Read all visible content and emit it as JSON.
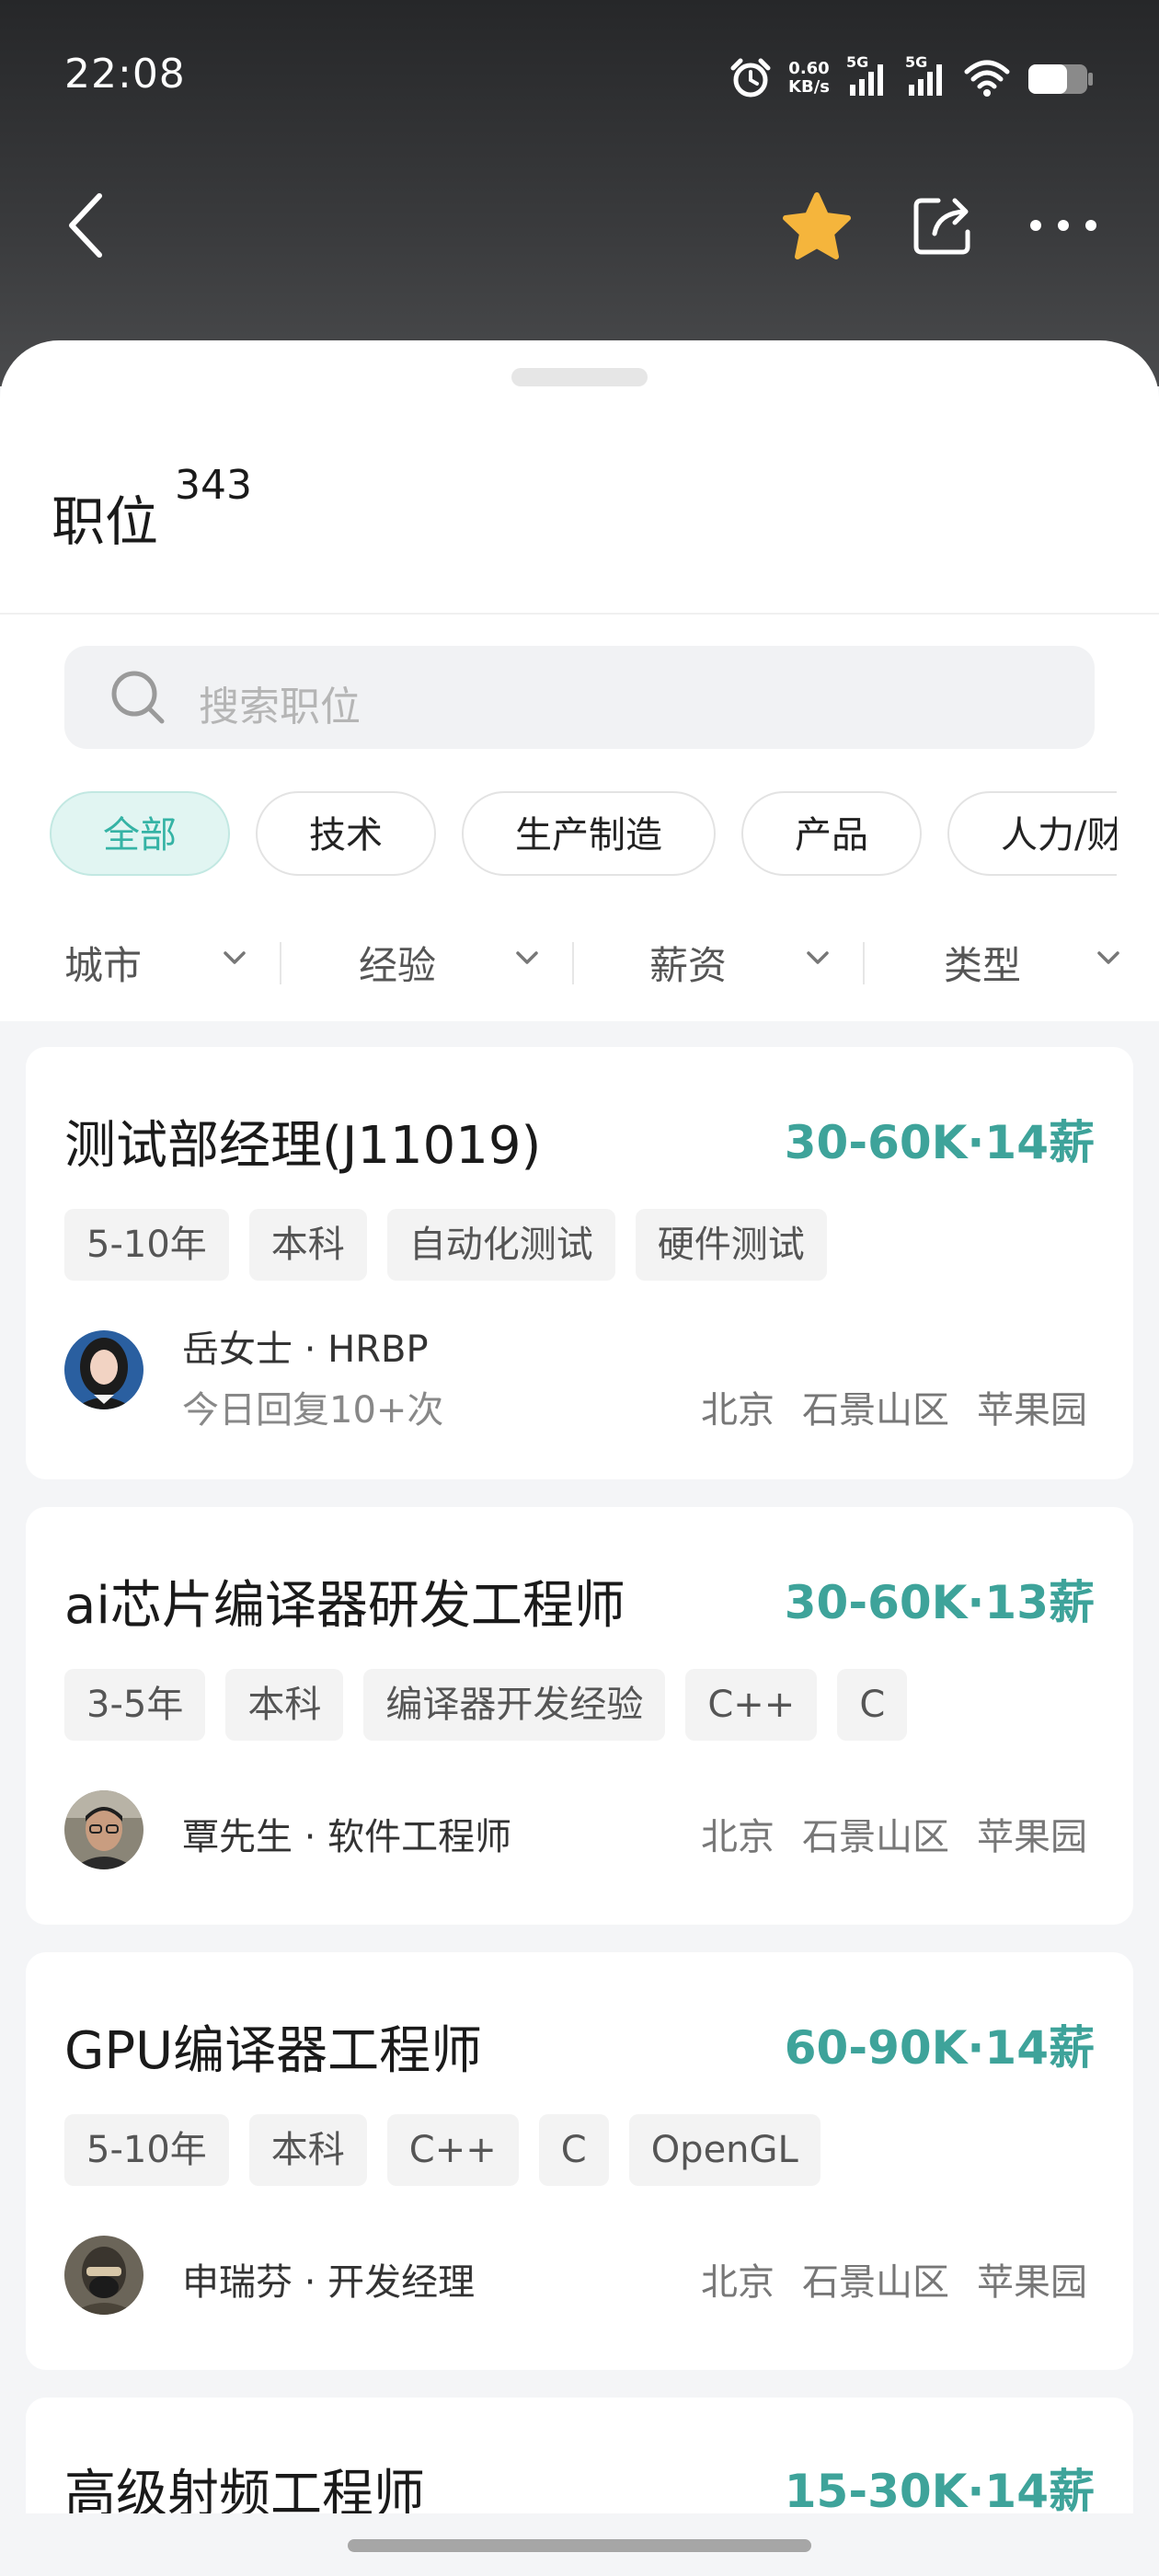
{
  "status_bar": {
    "time": "22:08",
    "net_speed_value": "0.60",
    "net_speed_unit": "KB/s",
    "sim1": "5G",
    "sim2": "5G",
    "icons": [
      "alarm-icon",
      "signal-icon",
      "signal-icon",
      "wifi-icon",
      "battery-icon"
    ]
  },
  "top_bar": {
    "icons": [
      "back-icon",
      "star-icon",
      "share-icon",
      "more-icon"
    ],
    "star_color": "#f5b53c"
  },
  "sheet": {
    "title": "职位",
    "count": "343",
    "search_placeholder": "搜索职位",
    "chips": [
      {
        "label": "全部",
        "active": true
      },
      {
        "label": "技术",
        "active": false
      },
      {
        "label": "生产制造",
        "active": false
      },
      {
        "label": "产品",
        "active": false
      },
      {
        "label": "人力/财",
        "active": false
      }
    ],
    "filters": [
      "城市",
      "经验",
      "薪资",
      "类型"
    ]
  },
  "jobs": [
    {
      "title": "测试部经理(J11019)",
      "salary": "30-60K·14薪",
      "tags": [
        "5-10年",
        "本科",
        "自动化测试",
        "硬件测试"
      ],
      "recruiter": "岳女士 · HRBP",
      "reply": "今日回复10+次",
      "location": [
        "北京",
        "石景山区",
        "苹果园"
      ]
    },
    {
      "title": "ai芯片编译器研发工程师",
      "salary": "30-60K·13薪",
      "tags": [
        "3-5年",
        "本科",
        "编译器开发经验",
        "C++",
        "C"
      ],
      "recruiter": "覃先生 · 软件工程师",
      "reply": "",
      "location": [
        "北京",
        "石景山区",
        "苹果园"
      ]
    },
    {
      "title": "GPU编译器工程师",
      "salary": "60-90K·14薪",
      "tags": [
        "5-10年",
        "本科",
        "C++",
        "C",
        "OpenGL"
      ],
      "recruiter": "申瑞芬 · 开发经理",
      "reply": "",
      "location": [
        "北京",
        "石景山区",
        "苹果园"
      ]
    },
    {
      "title": "高级射频工程师",
      "salary": "15-30K·14薪"
    }
  ],
  "accent_color": "#3ea39a"
}
